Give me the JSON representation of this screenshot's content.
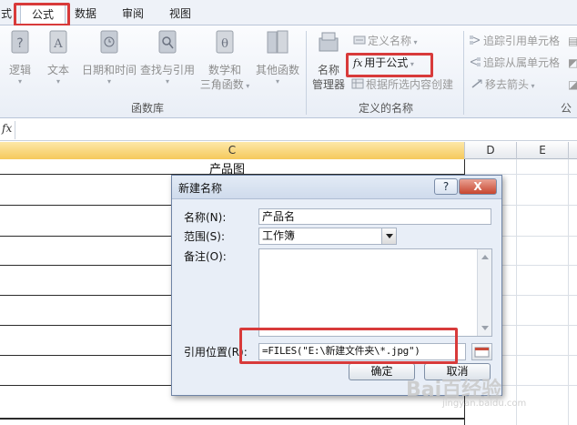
{
  "tabs": [
    {
      "label": "式",
      "partial": true
    },
    {
      "label": "公式",
      "active": true
    },
    {
      "label": "数据"
    },
    {
      "label": "审阅"
    },
    {
      "label": "视图"
    }
  ],
  "ribbon": {
    "function_library": {
      "buttons": [
        {
          "label": "逻辑",
          "icon": "logic-book-icon"
        },
        {
          "label": "文本",
          "icon": "text-book-icon"
        },
        {
          "label": "日期和时间",
          "icon": "datetime-book-icon"
        },
        {
          "label": "查找与引用",
          "icon": "lookup-book-icon"
        },
        {
          "label": "数学和",
          "label2": "三角函数",
          "icon": "math-book-icon"
        },
        {
          "label": "其他函数",
          "icon": "more-functions-book-icon"
        }
      ],
      "group_label": "函数库"
    },
    "defined_names": {
      "name_manager": {
        "label": "名称",
        "label2": "管理器",
        "icon": "name-manager-icon"
      },
      "define_name": "定义名称",
      "use_in_formula": "用于公式",
      "create_from_selection": "根据所选内容创建",
      "group_label": "定义的名称"
    },
    "auditing": {
      "trace_precedents": "追踪引用单元格",
      "trace_dependents": "追踪从属单元格",
      "remove_arrows": "移去箭头",
      "group_label_partial": "公"
    }
  },
  "formula_bar": {
    "fx": "fx"
  },
  "sheet": {
    "columns": [
      "C",
      "D",
      "E"
    ],
    "c_header_text": "产品图"
  },
  "dialog": {
    "title": "新建名称",
    "help": "?",
    "close": "X",
    "name_label": "名称(N):",
    "name_value": "产品名",
    "scope_label": "范围(S):",
    "scope_value": "工作簿",
    "comment_label": "备注(O):",
    "comment_value": "",
    "refers_to_label": "引用位置(R):",
    "refers_to_value": "=FILES(\"E:\\新建文件夹\\*.jpg\")",
    "ok": "确定",
    "cancel": "取消"
  },
  "watermark": {
    "text": "Bai百经验",
    "sub": "jingyan.baidu.com"
  },
  "colors": {
    "highlight": "#d83a3a",
    "selected_column": "#f5c95c",
    "close_button": "#c7462f"
  }
}
